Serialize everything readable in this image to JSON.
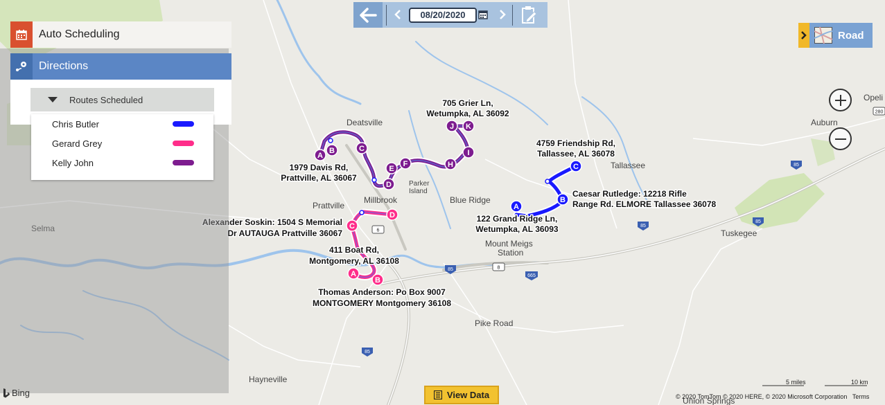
{
  "toolbar": {
    "date": "08/20/2020",
    "icons": [
      "arrow-left-icon",
      "chevron-left-icon",
      "calendar-icon",
      "chevron-right-icon",
      "clipboard-edit-icon"
    ]
  },
  "panel": {
    "auto_scheduling": "Auto Scheduling",
    "directions": "Directions",
    "routes_scheduled": "Routes Scheduled",
    "legend": [
      {
        "name": "Chris Butler",
        "color": "#1a1aff"
      },
      {
        "name": "Gerard Grey",
        "color": "#ff2d8a"
      },
      {
        "name": "Kelly John",
        "color": "#7d1c8f"
      }
    ]
  },
  "map_style": {
    "label": "Road"
  },
  "view_data": "View Data",
  "brand": "Bing",
  "copyright": "© 2020 TomTom © 2020 HERE, © 2020 Microsoft Corporation",
  "terms": "Terms",
  "scale": {
    "miles": "5 miles",
    "km": "10 km"
  },
  "place_names": {
    "deatsville": "Deatsville",
    "millbrook": "Millbrook",
    "prattville": "Prattville",
    "selma": "Selma",
    "blue_ridge": "Blue Ridge",
    "parker_island": "Parker\nIsland",
    "mount_meigs": "Mount Meigs\nStation",
    "tallassee": "Tallassee",
    "auburn": "Auburn",
    "opelika": "Opeli",
    "tuskegee": "Tuskegee",
    "pike_road": "Pike Road",
    "hayneville": "Hayneville",
    "union_springs": "Union Springs"
  },
  "highways": [
    "6",
    "85",
    "8",
    "85",
    "85",
    "665",
    "85",
    "85",
    "280"
  ],
  "address_labels": [
    {
      "line1": "705 Grier Ln,",
      "line2": "Wetumpka, AL 36092"
    },
    {
      "line1": "4759 Friendship Rd,",
      "line2": "Tallassee, AL 36078"
    },
    {
      "line1": "1979 Davis Rd,",
      "line2": "Prattville, AL 36067"
    },
    {
      "line1": "Caesar Rutledge: 12218 Rifle",
      "line2": "Range Rd. ELMORE Tallassee 36078"
    },
    {
      "line1": "122 Grand Ridge Ln,",
      "line2": "Wetumpka, AL 36093"
    },
    {
      "line1": "Alexander Soskin: 1504 S Memorial",
      "line2": "Dr AUTAUGA Prattville 36067"
    },
    {
      "line1": "411 Boat Rd,",
      "line2": "Montgomery, AL 36108"
    },
    {
      "line1": "Thomas Anderson: Po Box 9007",
      "line2": "MONTGOMERY Montgomery 36108"
    }
  ],
  "stops": {
    "chris_butler": [
      "A",
      "B",
      "C"
    ],
    "gerard_grey": [
      "A",
      "B",
      "C",
      "D"
    ],
    "kelly_john": [
      "A",
      "B",
      "C",
      "D",
      "E",
      "F",
      "H",
      "I",
      "J",
      "K"
    ]
  }
}
